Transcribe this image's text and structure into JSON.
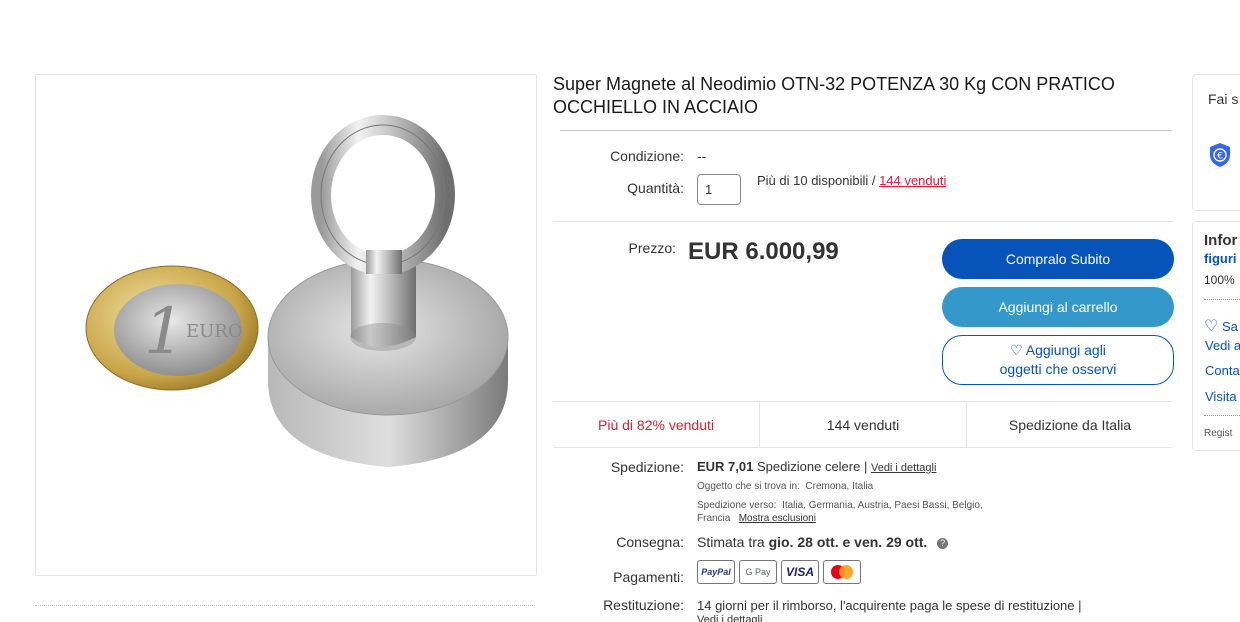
{
  "product": {
    "title": "Super Magnete al Neodimio OTN-32 POTENZA 30 Kg CON PRATICO OCCHIELLO IN ACCIAIO",
    "image_alt": "magnete con occhiello accanto a moneta da 1 euro"
  },
  "details": {
    "condition_label": "Condizione:",
    "condition_value": "--",
    "quantity_label": "Quantità:",
    "quantity_value": "1",
    "availability_text": "Più di 10 disponibili / ",
    "sold_link": "144 venduti"
  },
  "price": {
    "label": "Prezzo:",
    "value": "EUR 6.000,99"
  },
  "buttons": {
    "buy_now": "Compralo Subito",
    "add_to_cart": "Aggiungi al carrello",
    "watch_line1": "Aggiungi agli",
    "watch_line2": "oggetti che osservi"
  },
  "stats": {
    "hot": "Più di 82% venduti",
    "sold": "144 venduti",
    "shipping_from": "Spedizione da Italia"
  },
  "shipping": {
    "label": "Spedizione:",
    "cost": "EUR 7,01",
    "method": "Spedizione celere |",
    "details_link": "Vedi i dettagli",
    "location_label": "Oggetto che si trova in:",
    "location_value": "Cremona, Italia",
    "ships_to_label": "Spedizione verso:",
    "ships_to_value": "Italia, Germania, Austria, Paesi Bassi, Belgio,",
    "ships_to_value2": "Francia",
    "exclusions_link": "Mostra esclusioni"
  },
  "delivery": {
    "label": "Consegna:",
    "prefix": "Stimata tra ",
    "dates": "gio. 28 ott. e ven. 29 ott."
  },
  "payments": {
    "label": "Pagamenti:",
    "methods": [
      "PayPal",
      "G Pay",
      "VISA",
      "Mastercard"
    ]
  },
  "returns": {
    "label": "Restituzione:",
    "text": "14 giorni per il rimborso, l'acquirente paga le spese di restituzione |",
    "details_link": "Vedi i dettagli"
  },
  "sidebar": {
    "box1_text": "Fai s",
    "box2_title": "Infor",
    "box2_link": "figuri",
    "box2_percent": "100%",
    "save_seller": "Sa",
    "see_other": "Vedi a",
    "contact": "Conta",
    "visit": "Visita",
    "register": "Regist"
  },
  "colors": {
    "primary": "#0654ba",
    "secondary": "#3498ca",
    "hot": "#dd1e31"
  },
  "icons": {
    "euro_shield": "euro-shield-icon",
    "heart": "heart-icon",
    "info": "info-icon"
  }
}
